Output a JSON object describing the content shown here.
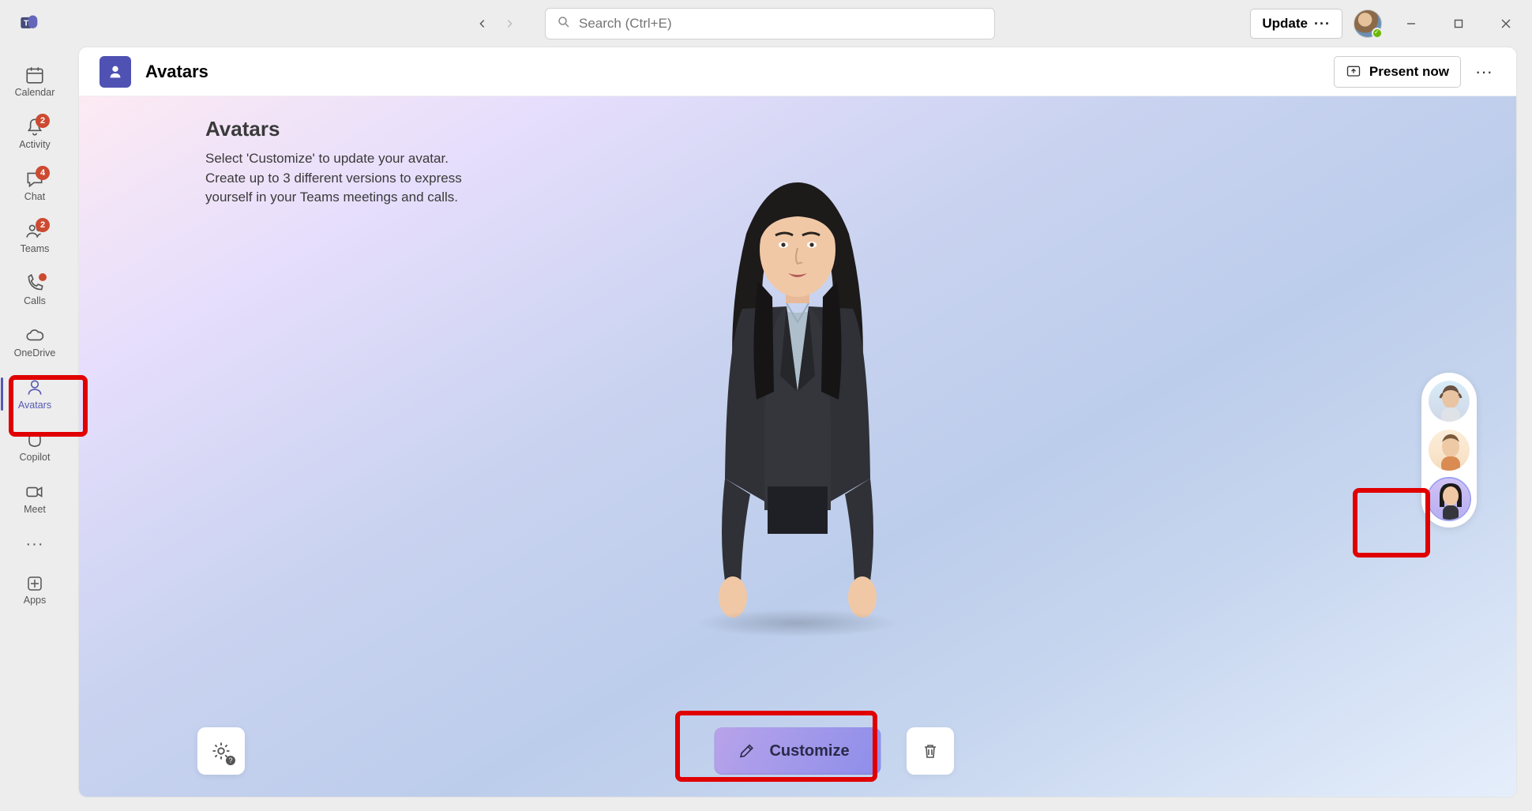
{
  "titlebar": {
    "search_placeholder": "Search (Ctrl+E)",
    "update_label": "Update"
  },
  "rail": {
    "calendar": {
      "label": "Calendar"
    },
    "activity": {
      "label": "Activity",
      "badge": "2"
    },
    "chat": {
      "label": "Chat",
      "badge": "4"
    },
    "teams": {
      "label": "Teams",
      "badge": "2"
    },
    "calls": {
      "label": "Calls"
    },
    "onedrive": {
      "label": "OneDrive"
    },
    "avatars": {
      "label": "Avatars"
    },
    "copilot": {
      "label": "Copilot"
    },
    "meet": {
      "label": "Meet"
    },
    "apps": {
      "label": "Apps"
    }
  },
  "header": {
    "title": "Avatars",
    "present_label": "Present now"
  },
  "info": {
    "heading": "Avatars",
    "line1": "Select 'Customize' to update your avatar.",
    "line2": "Create up to 3 different versions to express yourself in your Teams meetings and calls."
  },
  "controls": {
    "customize_label": "Customize"
  },
  "selector": {
    "slots": [
      {
        "name": "avatar-slot-1",
        "active": false
      },
      {
        "name": "avatar-slot-2",
        "active": false
      },
      {
        "name": "avatar-slot-3",
        "active": true
      }
    ]
  }
}
